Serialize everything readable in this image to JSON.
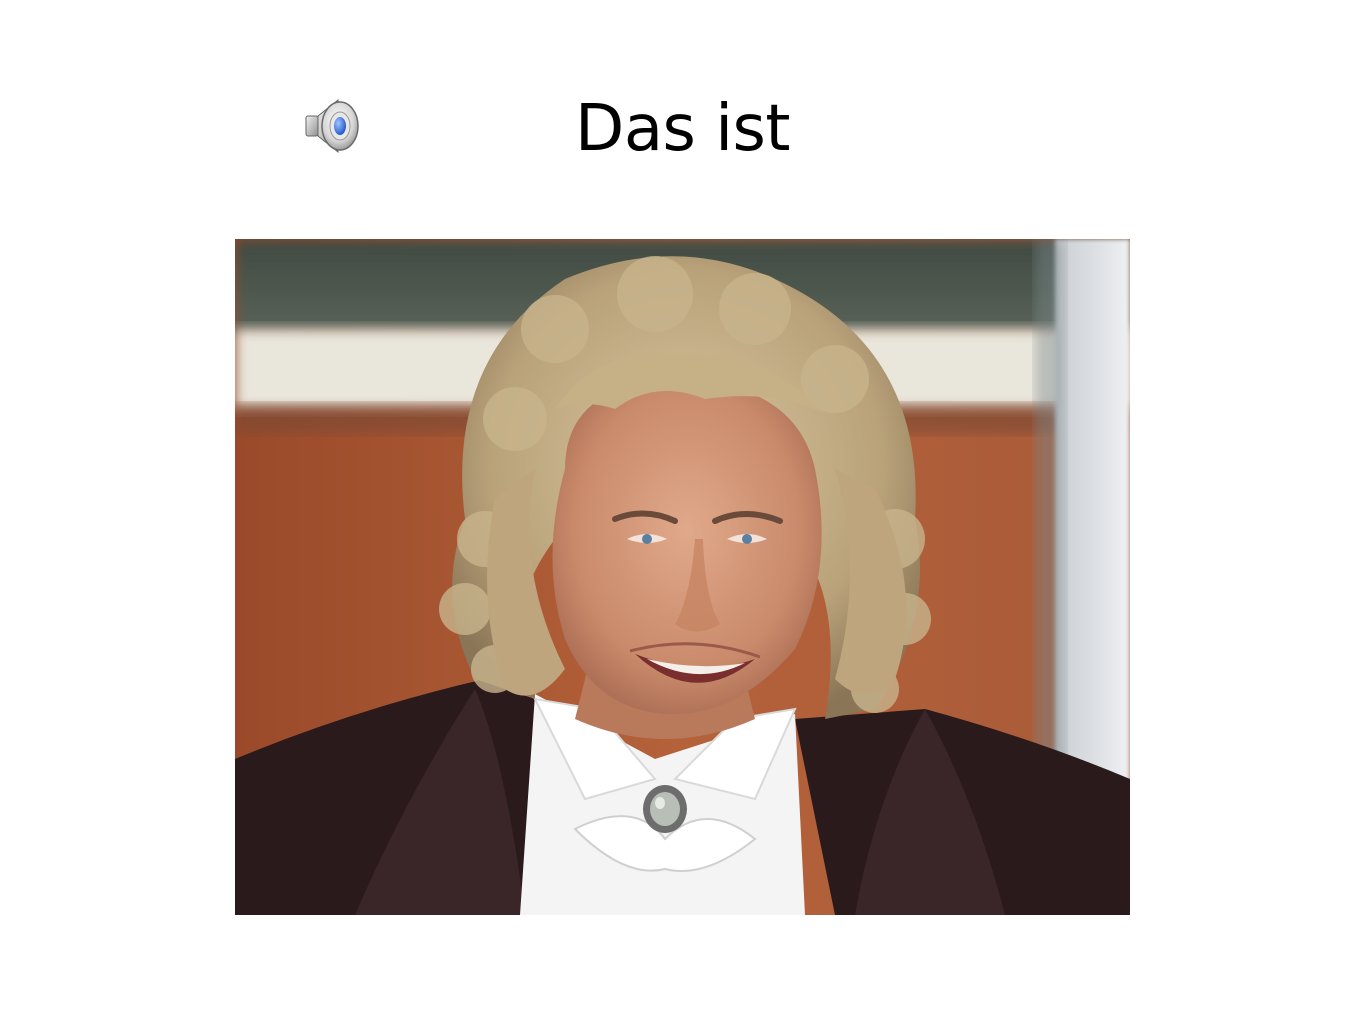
{
  "slide": {
    "title": "Das ist",
    "audio_icon": "speaker-icon",
    "photo_subject": "portrait-photo"
  },
  "colors": {
    "background": "#ffffff",
    "title_text": "#000000",
    "speaker_blue": "#2f6fe0"
  }
}
